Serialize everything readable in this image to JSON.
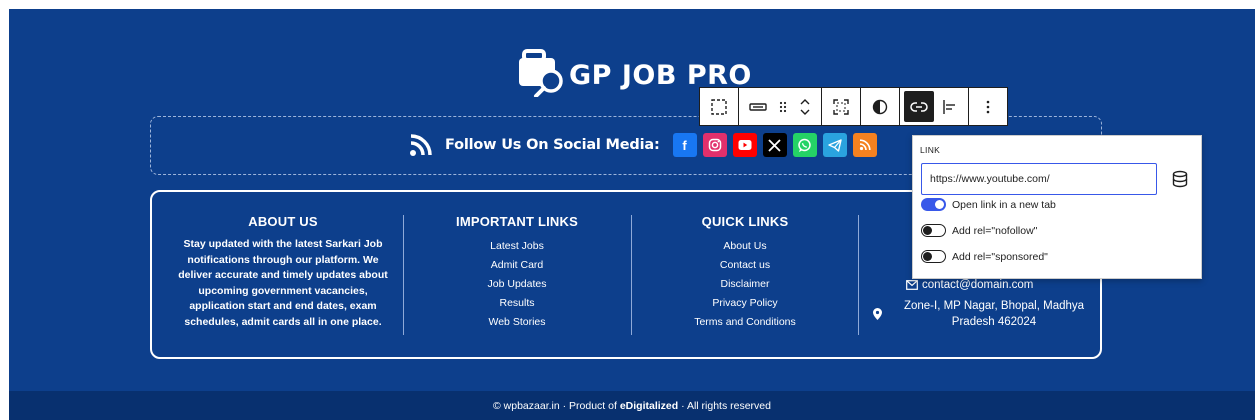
{
  "brand": {
    "name": "GP JOB PRO"
  },
  "social": {
    "label": "Follow Us On Social Media:",
    "icons": [
      {
        "name": "facebook",
        "glyph": "f",
        "color": "#1877f2"
      },
      {
        "name": "instagram",
        "glyph": "",
        "color": "#e1306c"
      },
      {
        "name": "youtube",
        "glyph": "",
        "color": "#ff0000"
      },
      {
        "name": "x-twitter",
        "glyph": "𝕏",
        "color": "#000000"
      },
      {
        "name": "whatsapp",
        "glyph": "",
        "color": "#25d366"
      },
      {
        "name": "telegram",
        "glyph": "",
        "color": "#2aa3df"
      },
      {
        "name": "rss",
        "glyph": "",
        "color": "#f58220"
      }
    ]
  },
  "footer": {
    "about": {
      "title": "ABOUT US",
      "text": "Stay updated with the latest Sarkari Job notifications through our platform. We deliver accurate and timely updates about upcoming government vacancies, application start and end dates, exam schedules, admit cards all in one place."
    },
    "important": {
      "title": "IMPORTANT LINKS",
      "links": [
        "Latest Jobs",
        "Admit Card",
        "Job Updates",
        "Results",
        "Web Stories"
      ]
    },
    "quick": {
      "title": "QUICK LINKS",
      "links": [
        "About Us",
        "Contact us",
        "Disclaimer",
        "Privacy Policy",
        "Terms and Conditions"
      ]
    },
    "contact": {
      "email": "contact@domain.com",
      "address": "Zone-I, MP Nagar, Bhopal, Madhya Pradesh 462024"
    }
  },
  "copyright": {
    "prefix": "© wpbazaar.in · Product of ",
    "company": "eDigitalized",
    "suffix": " · All rights reserved"
  },
  "link_popover": {
    "label": "LINK",
    "url": "https://www.youtube.com/",
    "toggles": [
      {
        "label": "Open link in a new tab",
        "on": true
      },
      {
        "label": "Add rel=\"nofollow\"",
        "on": false
      },
      {
        "label": "Add rel=\"sponsored\"",
        "on": false
      }
    ]
  },
  "colors": {
    "background": "#0d3f8c",
    "bottom_bar": "#08306f",
    "accent": "#3858e9"
  }
}
